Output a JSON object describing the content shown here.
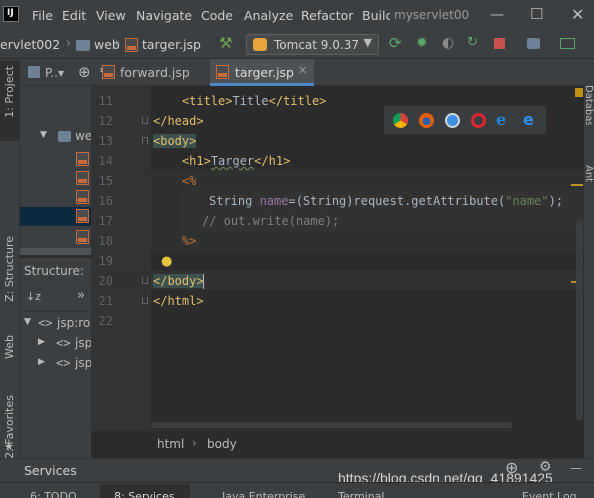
{
  "menubar": {
    "items": [
      "File",
      "Edit",
      "View",
      "Navigate",
      "Code",
      "Analyze",
      "Refactor",
      "Builc"
    ],
    "window_title": "myservlet00"
  },
  "navbar": {
    "project": "ervlet002",
    "folder": "web",
    "file": "targer.jsp",
    "run_config": "Tomcat 9.0.37"
  },
  "project_panel": {
    "title": "P..▾",
    "tree_root": "we"
  },
  "tabs": [
    {
      "label": "forward.jsp"
    },
    {
      "label": "targer.jsp"
    }
  ],
  "editor": {
    "line_numbers": [
      "11",
      "12",
      "13",
      "14",
      "15",
      "16",
      "17",
      "18",
      "19",
      "20",
      "21",
      "22"
    ],
    "lines": {
      "l11": {
        "indent": "    ",
        "open": "<title>",
        "text": "Title",
        "close": "</title>"
      },
      "l12": {
        "tag": "</head>"
      },
      "l13": {
        "tag": "<body>"
      },
      "l14": {
        "indent": "    ",
        "open": "<h1>",
        "text": "Targer",
        "close": "</h1>"
      },
      "l15": {
        "indent": "    ",
        "kw": "<%"
      },
      "l16": {
        "t1": "String ",
        "var": "name",
        "t2": "=(String)request.getAttribute(",
        "str": "\"name\"",
        "t3": ");"
      },
      "l17": {
        "cmt": "// out.write(name);"
      },
      "l18": {
        "indent": "    ",
        "kw": "%>"
      },
      "l20": {
        "tag": "</body>"
      },
      "l21": {
        "tag": "</html>"
      }
    }
  },
  "breadcrumb": {
    "items": [
      "html",
      "body"
    ]
  },
  "structure_panel": {
    "title": "Structure:",
    "items": [
      "jsp:ro",
      "jsp",
      "jsp"
    ]
  },
  "services": {
    "label": "Services"
  },
  "left_stripe": {
    "project": "1: Project",
    "structure": "Z: Structure",
    "web": "Web",
    "favorites": "2: Favorites"
  },
  "right_stripe": {
    "database": "Database",
    "ant": "Ant"
  },
  "watermark": "https://blog.csdn.net/qq_41891425",
  "bottom_tabs": [
    "6: TODO",
    "8: Services",
    "Java Enterprise",
    "Terminal",
    "Event Log"
  ]
}
